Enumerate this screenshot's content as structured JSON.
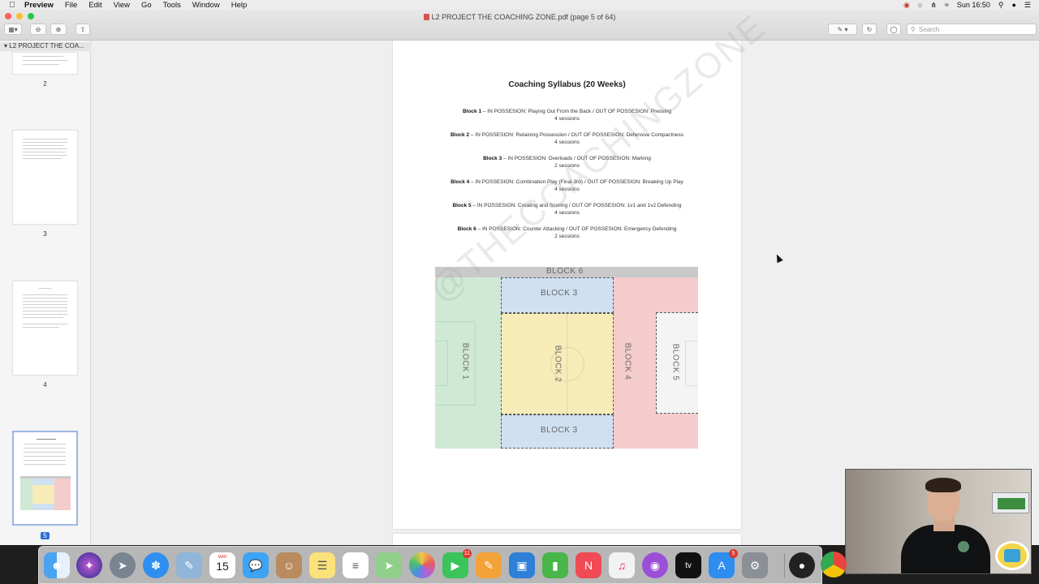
{
  "menubar": {
    "app_name": "Preview",
    "items": [
      "File",
      "Edit",
      "View",
      "Go",
      "Tools",
      "Window",
      "Help"
    ],
    "clock": "Sun 16:50"
  },
  "window": {
    "title": "L2 PROJECT THE COACHING ZONE.pdf (page 5 of 64)",
    "search_placeholder": "Search"
  },
  "sidebar": {
    "header": "L2 PROJECT THE COA...",
    "pages": [
      "2",
      "3",
      "4",
      "5"
    ],
    "selected_page": "5"
  },
  "document": {
    "title": "Coaching Syllabus (20 Weeks)",
    "blocks": [
      {
        "name": "Block 1",
        "text": " – IN POSSESION: Playing Out From the Back / OUT OF POSSESION: Pressing",
        "sessions": "4 sessions"
      },
      {
        "name": "Block 2",
        "text": " – IN POSSESION: Retaining Possession / OUT OF POSSESION: Defensive Compactness",
        "sessions": "4 sessions"
      },
      {
        "name": "Block 3",
        "text": " – IN POSSESION: Overloads / OUT OF POSSESION: Marking",
        "sessions": "2 sessions"
      },
      {
        "name": "Block 4",
        "text": " – IN POSSESION: Combination Play (Final 3rd) / OUT OF POSSESION: Breaking Up Play",
        "sessions": "4 sessions"
      },
      {
        "name": "Block 5",
        "text": " – IN POSSESION: Creating and Scoring / OUT OF POSSESION: 1v1 and 1v2 Defending",
        "sessions": "4 sessions"
      },
      {
        "name": "Block 6",
        "text": " – IN POSSESION: Counter Attacking / OUT OF POSSESION: Emergency Defending",
        "sessions": "2 sessions"
      }
    ],
    "pitch": {
      "block6": "BLOCK 6",
      "block3_top": "BLOCK 3",
      "block3_bottom": "BLOCK 3",
      "block1": "BLOCK 1",
      "block2": "BLOCK 2",
      "block4": "BLOCK 4",
      "block5": "BLOCK 5",
      "colors": {
        "block1": "#cfe9d4",
        "block2": "#f7ebb8",
        "block3": "#cfe0f1",
        "block4": "#f4cccb",
        "block5": "#f4f4f4",
        "block6": "#c9c9c9"
      }
    },
    "watermark": "@THECOACHINGZONE"
  },
  "dock": {
    "calendar_month": "MAR",
    "calendar_day": "15",
    "facetime_badge": "11",
    "appstore_badge": "5",
    "apps": [
      "finder-icon",
      "siri-icon",
      "launchpad-icon",
      "safari-icon",
      "preview-icon",
      "calendar-icon",
      "messages-icon",
      "contacts-icon",
      "notes-icon",
      "reminders-icon",
      "maps-icon",
      "photos-icon",
      "facetime-icon",
      "pages-icon",
      "keynote-icon",
      "numbers-icon",
      "news-icon",
      "music-icon",
      "podcasts-icon",
      "tv-icon",
      "appstore-icon",
      "system-preferences-icon",
      "obs-icon",
      "chrome-icon"
    ]
  }
}
